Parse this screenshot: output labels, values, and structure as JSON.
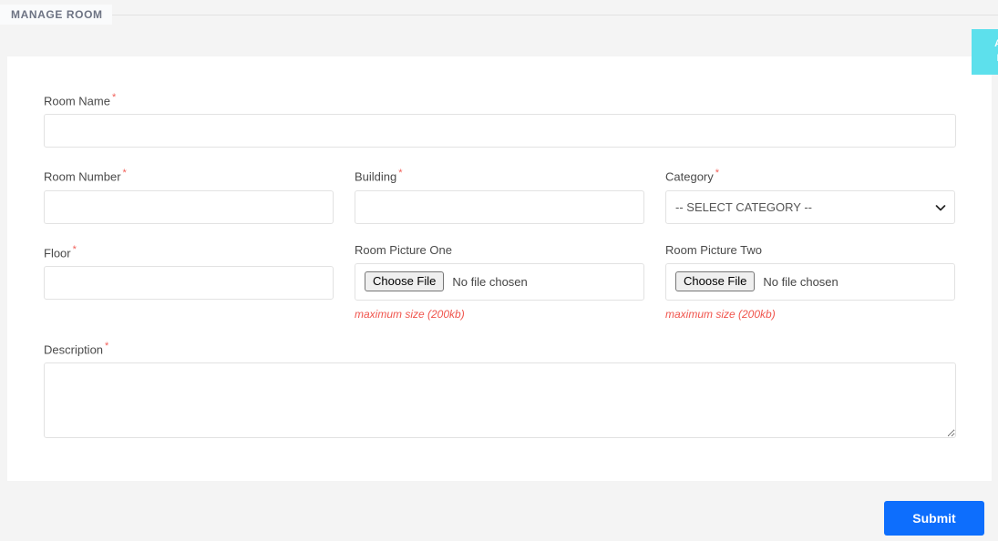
{
  "header": {
    "title": "MANAGE ROOM"
  },
  "side_tab": {
    "line1": "Ava",
    "line2": "Ro",
    "color": "#5de0ec"
  },
  "form": {
    "room_name": {
      "label": "Room Name",
      "required": "*",
      "value": "",
      "placeholder": ""
    },
    "room_number": {
      "label": "Room Number",
      "required": "*",
      "value": "",
      "placeholder": ""
    },
    "building": {
      "label": "Building",
      "required": "*",
      "value": "",
      "placeholder": ""
    },
    "category": {
      "label": "Category",
      "required": "*",
      "selected": "-- SELECT CATEGORY --",
      "options": [
        "-- SELECT CATEGORY --"
      ]
    },
    "floor": {
      "label": "Floor",
      "required": "*",
      "value": "",
      "placeholder": ""
    },
    "room_picture_one": {
      "label": "Room Picture One",
      "button_label": "Choose File",
      "status": "No file chosen",
      "help": "maximum size (200kb)"
    },
    "room_picture_two": {
      "label": "Room Picture Two",
      "button_label": "Choose File",
      "status": "No file chosen",
      "help": "maximum size (200kb)"
    },
    "description": {
      "label": "Description",
      "required": "*",
      "value": "",
      "placeholder": ""
    }
  },
  "footer": {
    "submit_label": "Submit",
    "submit_color": "#0d6efd"
  }
}
